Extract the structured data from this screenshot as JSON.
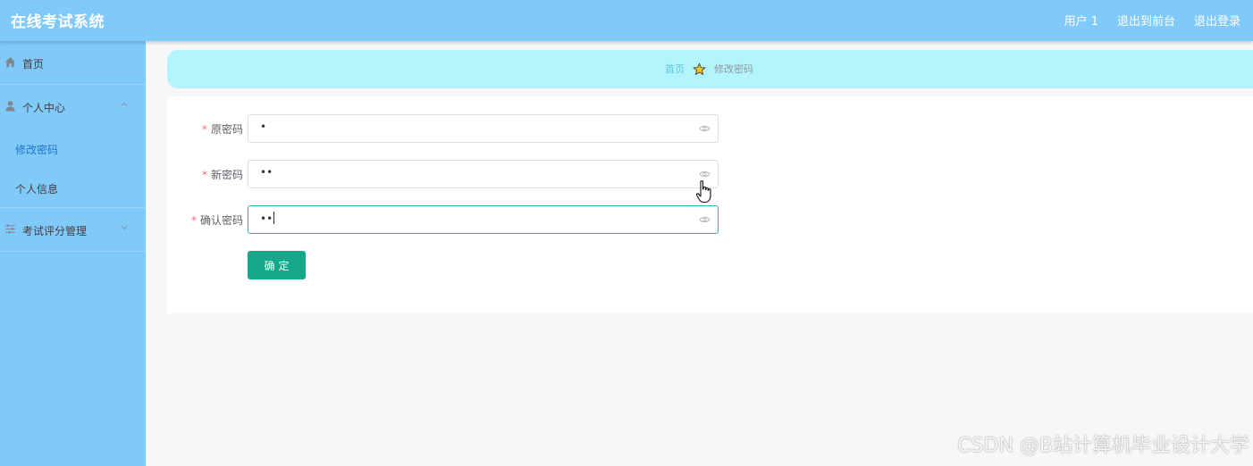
{
  "header": {
    "app_title": "在线考试系统",
    "user_label": "用户 1",
    "exit_front_label": "退出到前台",
    "logout_label": "退出登录"
  },
  "sidebar": {
    "home": {
      "label": "首页",
      "icon": "home-icon"
    },
    "personal_center": {
      "label": "个人中心",
      "icon": "user-icon",
      "expanded": true,
      "children": [
        {
          "label": "修改密码",
          "active": true
        },
        {
          "label": "个人信息",
          "active": false
        }
      ]
    },
    "exam_score": {
      "label": "考试评分管理",
      "icon": "sliders-icon",
      "expanded": false
    }
  },
  "breadcrumb": {
    "home": "首页",
    "separator_icon": "star-icon",
    "current": "修改密码"
  },
  "form": {
    "old_password": {
      "label": "原密码",
      "value": "•",
      "required": true
    },
    "new_password": {
      "label": "新密码",
      "value": "••",
      "required": true
    },
    "confirm_password": {
      "label": "确认密码",
      "value": "••",
      "required": true,
      "focused": true
    },
    "submit_label": "确定"
  },
  "watermark": "CSDN @B站计算机毕业设计大学",
  "colors": {
    "header_bg": "#80cafa",
    "sidebar_bg": "#80cafa",
    "breadcrumb_bg": "#b4f4fc",
    "primary_button": "#16a88a",
    "active_menu_text": "#1f76c7",
    "required_star": "#f56c6c",
    "focus_border": "#2bb8a8"
  }
}
